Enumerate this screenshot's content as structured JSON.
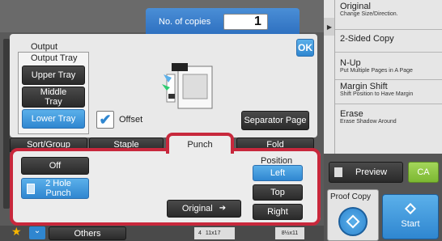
{
  "copies": {
    "label": "No. of copies",
    "value": "1"
  },
  "ok_label": "OK",
  "output": {
    "section_label": "Output",
    "tray_label": "Output Tray",
    "trays": [
      "Upper Tray",
      "Middle Tray",
      "Lower Tray"
    ],
    "selected_tray": "Lower Tray",
    "offset_label": "Offset",
    "offset_checked": true,
    "separator_label": "Separator Page"
  },
  "tabs": [
    "Sort/Group",
    "Staple",
    "Punch",
    "Fold"
  ],
  "active_tab": "Punch",
  "punch": {
    "off_label": "Off",
    "two_hole_label": "2 Hole Punch",
    "position_label": "Position",
    "positions": [
      "Left",
      "Top",
      "Right"
    ],
    "selected_position": "Left",
    "original_label": "Original"
  },
  "bottom": {
    "others_label": "Others",
    "paper_num": "4",
    "paper_a": "11x17",
    "paper_b": "8½x11"
  },
  "right_panel": {
    "items": [
      {
        "title": "Original",
        "sub": "Change Size/Direction."
      },
      {
        "title": "2-Sided Copy",
        "sub": ""
      },
      {
        "title": "N-Up",
        "sub": "Put Multiple Pages in A Page"
      },
      {
        "title": "Margin Shift",
        "sub": "Shift Position to Have Margin"
      },
      {
        "title": "Erase",
        "sub": "Erase Shadow Around"
      }
    ],
    "preview_label": "Preview",
    "ca_label": "CA",
    "proof_label": "Proof Copy",
    "start_label": "Start"
  },
  "colors": {
    "accent_blue": "#2f86d0",
    "highlight_red": "#c8283c",
    "ca_green": "#8cc63f"
  }
}
